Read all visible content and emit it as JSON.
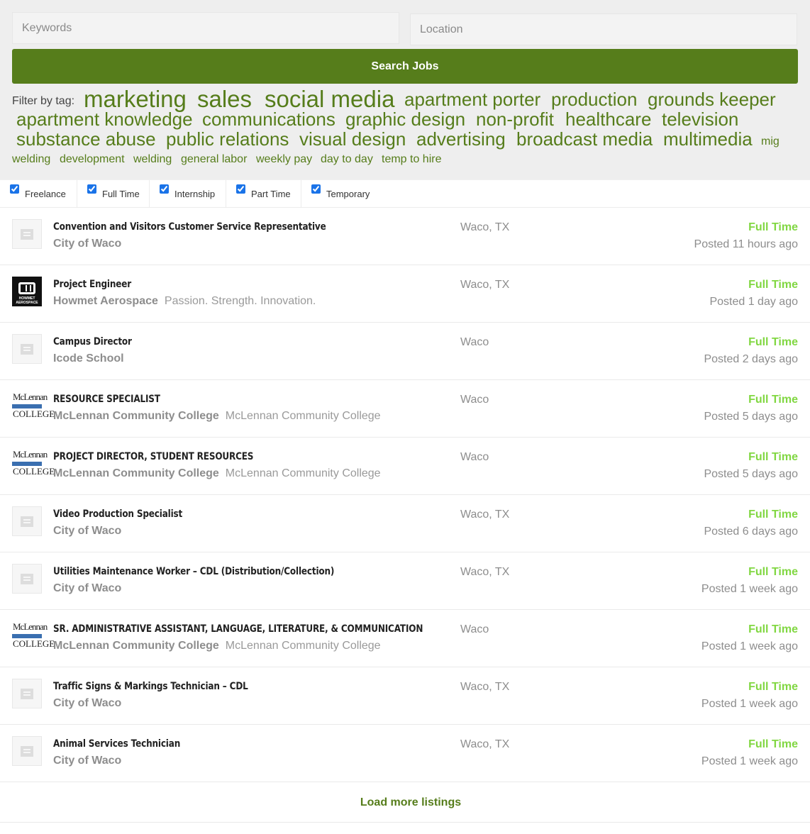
{
  "search": {
    "keywords_placeholder": "Keywords",
    "location_placeholder": "Location",
    "button_label": "Search Jobs",
    "accent_color": "#567d1b"
  },
  "tags": {
    "label": "Filter by tag:",
    "items": [
      "marketing",
      "sales",
      "social media",
      "apartment porter",
      "production",
      "grounds keeper",
      "apartment knowledge",
      "communications",
      "graphic design",
      "non-profit",
      "healthcare",
      "television",
      "substance abuse",
      "public relations",
      "visual design",
      "advertising",
      "broadcast media",
      "multimedia",
      "mig",
      "welding",
      "development",
      "welding",
      "general labor",
      "weekly pay",
      "day to day",
      "temp to hire"
    ]
  },
  "filters": [
    {
      "label": "Freelance",
      "checked": true
    },
    {
      "label": "Full Time",
      "checked": true
    },
    {
      "label": "Internship",
      "checked": true
    },
    {
      "label": "Part Time",
      "checked": true
    },
    {
      "label": "Temporary",
      "checked": true
    }
  ],
  "listings": [
    {
      "title": "Convention and Visitors Customer Service Representative",
      "company": "City of Waco",
      "tagline": "",
      "location": "Waco, TX",
      "type": "Full Time",
      "posted": "Posted 11 hours ago",
      "logo": "placeholder-company-logo"
    },
    {
      "title": "Project Engineer",
      "company": "Howmet Aerospace",
      "tagline": "Passion. Strength. Innovation.",
      "location": "Waco, TX",
      "type": "Full Time",
      "posted": "Posted 1 day ago",
      "logo": "howmet-logo"
    },
    {
      "title": "Campus Director",
      "company": "Icode School",
      "tagline": "",
      "location": "Waco",
      "type": "Full Time",
      "posted": "Posted 2 days ago",
      "logo": "placeholder-company-logo"
    },
    {
      "title": "RESOURCE SPECIALIST",
      "company": "McLennan Community College",
      "tagline": "McLennan Community College",
      "location": "Waco",
      "type": "Full Time",
      "posted": "Posted 5 days ago",
      "logo": "mclennan-college-logo"
    },
    {
      "title": "PROJECT DIRECTOR, STUDENT RESOURCES",
      "company": "McLennan Community College",
      "tagline": "McLennan Community College",
      "location": "Waco",
      "type": "Full Time",
      "posted": "Posted 5 days ago",
      "logo": "mclennan-college-logo"
    },
    {
      "title": "Video Production Specialist",
      "company": "City of Waco",
      "tagline": "",
      "location": "Waco, TX",
      "type": "Full Time",
      "posted": "Posted 6 days ago",
      "logo": "placeholder-company-logo"
    },
    {
      "title": "Utilities Maintenance Worker – CDL (Distribution/Collection)",
      "company": "City of Waco",
      "tagline": "",
      "location": "Waco, TX",
      "type": "Full Time",
      "posted": "Posted 1 week ago",
      "logo": "placeholder-company-logo"
    },
    {
      "title": "SR. ADMINISTRATIVE ASSISTANT, LANGUAGE, LITERATURE, & COMMUNICATION",
      "company": "McLennan Community College",
      "tagline": "McLennan Community College",
      "location": "Waco",
      "type": "Full Time",
      "posted": "Posted 1 week ago",
      "logo": "mclennan-college-logo"
    },
    {
      "title": "Traffic Signs & Markings Technician – CDL",
      "company": "City of Waco",
      "tagline": "",
      "location": "Waco, TX",
      "type": "Full Time",
      "posted": "Posted 1 week ago",
      "logo": "placeholder-company-logo"
    },
    {
      "title": "Animal Services Technician",
      "company": "City of Waco",
      "tagline": "",
      "location": "Waco, TX",
      "type": "Full Time",
      "posted": "Posted 1 week ago",
      "logo": "placeholder-company-logo"
    }
  ],
  "logos": {
    "howmet_text": "HOWMET AEROSPACE",
    "mcc_line1": "McLennan",
    "mcc_line2": "COLLEGE"
  },
  "load_more_label": "Load more listings",
  "type_color": "#81d742"
}
